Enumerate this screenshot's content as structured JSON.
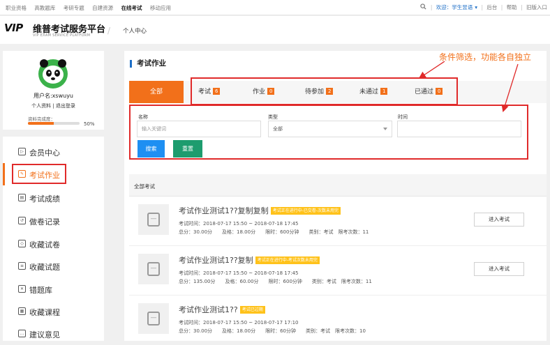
{
  "topbar": {
    "nav": [
      "职业资格",
      "高教题库",
      "考研专题",
      "自建资源",
      "在线考试",
      "移动应用"
    ],
    "active_nav": "在线考试",
    "welcome": "欢迎：学生昱语",
    "links": [
      "后台",
      "帮助",
      "旧版入口"
    ]
  },
  "header": {
    "logo_vip": "VIP",
    "logo_text": "维普考试服务平台",
    "logo_en": "VIP EXAM SERVICE PLATFORM",
    "breadcrumb_sep": "/",
    "breadcrumb_page": "个人中心"
  },
  "profile": {
    "username": "用户名:xswuyu",
    "link_info": "个人资料",
    "link_sep": "|",
    "link_logout": "退出登录",
    "complete_label": "资料完成度：",
    "complete_pct_text": "50%",
    "complete_fraction": 0.5
  },
  "menu": [
    {
      "label": "会员中心",
      "icon": "member-icon",
      "glyph": "▷"
    },
    {
      "label": "考试作业",
      "icon": "exam-homework-icon",
      "glyph": "✎"
    },
    {
      "label": "考试成绩",
      "icon": "score-icon",
      "glyph": "▤"
    },
    {
      "label": "做卷记录",
      "icon": "history-icon",
      "glyph": "↺"
    },
    {
      "label": "收藏试卷",
      "icon": "favorite-paper-icon",
      "glyph": "◇"
    },
    {
      "label": "收藏试题",
      "icon": "favorite-question-icon",
      "glyph": "≡"
    },
    {
      "label": "错题库",
      "icon": "wrong-question-icon",
      "glyph": "✕"
    },
    {
      "label": "收藏课程",
      "icon": "course-icon",
      "glyph": "▦"
    },
    {
      "label": "建议意见",
      "icon": "feedback-icon",
      "glyph": "…"
    }
  ],
  "panel": {
    "title": "考试作业"
  },
  "tabs": [
    {
      "label": "全部",
      "count": ""
    },
    {
      "label": "考试",
      "count": "6"
    },
    {
      "label": "作业",
      "count": "0"
    },
    {
      "label": "待参加",
      "count": "2"
    },
    {
      "label": "未通过",
      "count": "1"
    },
    {
      "label": "已通过",
      "count": "0"
    }
  ],
  "filters": {
    "name_label": "名称",
    "name_placeholder": "输入关键词",
    "type_label": "类型",
    "type_value": "全部",
    "time_label": "时间",
    "search_button": "搜索",
    "reset_button": "重置"
  },
  "annotation": "条件筛选，功能各自独立",
  "list": {
    "header": "全部考试",
    "enter_label": "进入考试",
    "items": [
      {
        "title": "考试作业测试1??复制复制",
        "badge": "考试正在进行中-已交卷-次数未用完",
        "time": "考试时间：2018-07-17 15:50 ~ 2018-07-18 17:45",
        "info": "总分：30.00分　　及格：18.00分　　限时：600分钟　　类别：考试　限考次数：11"
      },
      {
        "title": "考试作业测试1??复制",
        "badge": "考试正在进行中-考试次数未用完",
        "time": "考试时间：2018-07-17 15:50 ~ 2018-07-18 17:45",
        "info": "总分：135.00分　　及格：60.00分　　限时：600分钟　　类别：考试　限考次数：11"
      },
      {
        "title": "考试作业测试1??",
        "badge": "考试已过期",
        "time": "考试时间：2018-07-17 15:50 ~ 2018-07-17 17:10",
        "info": "总分：30.00分　　及格：18.00分　　限时：60分钟　　类别：考试　限考次数：10"
      }
    ]
  },
  "colors": {
    "accent": "#f2701a",
    "primary_blue": "#1e8ff2",
    "reset_green": "#1d9c6e",
    "highlight_red": "#e02a2a",
    "status_yellow": "#ffc21a"
  }
}
